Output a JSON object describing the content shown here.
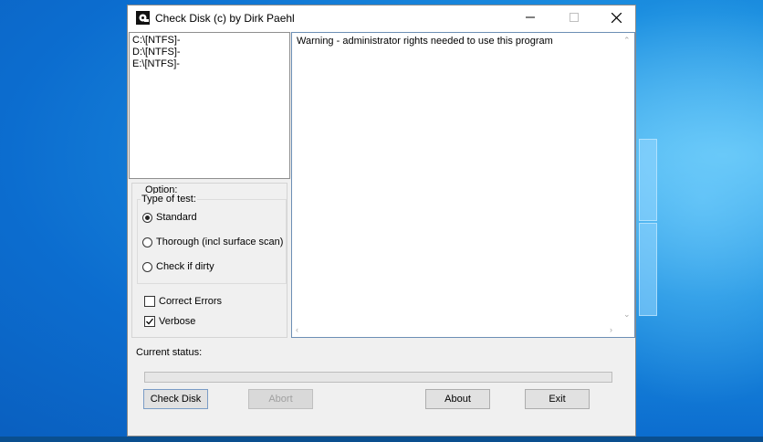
{
  "window": {
    "title": "Check Disk (c) by Dirk Paehl"
  },
  "drives": [
    "C:\\[NTFS]-",
    "D:\\[NTFS]-",
    "E:\\[NTFS]-"
  ],
  "output": {
    "text": "Warning - administrator rights needed to use this program"
  },
  "options": {
    "label": "Option:",
    "type_label": "Type of test:",
    "radios": [
      {
        "label": "Standard",
        "checked": true
      },
      {
        "label": "Thorough (incl surface scan)",
        "checked": false
      },
      {
        "label": "Check if dirty",
        "checked": false
      }
    ],
    "checkboxes": [
      {
        "label": "Correct Errors",
        "checked": false
      },
      {
        "label": "Verbose",
        "checked": true
      }
    ]
  },
  "status": {
    "label": "Current status:",
    "progress": 0
  },
  "buttons": {
    "check": "Check Disk",
    "abort": "Abort",
    "about": "About",
    "exit": "Exit"
  },
  "colors": {
    "progress_fill": "#06b025",
    "output_border": "#6d8fb5"
  },
  "icons": {
    "app": "check-disk-app-icon",
    "minimize": "minimize-icon",
    "maximize": "maximize-icon",
    "close": "close-icon"
  }
}
